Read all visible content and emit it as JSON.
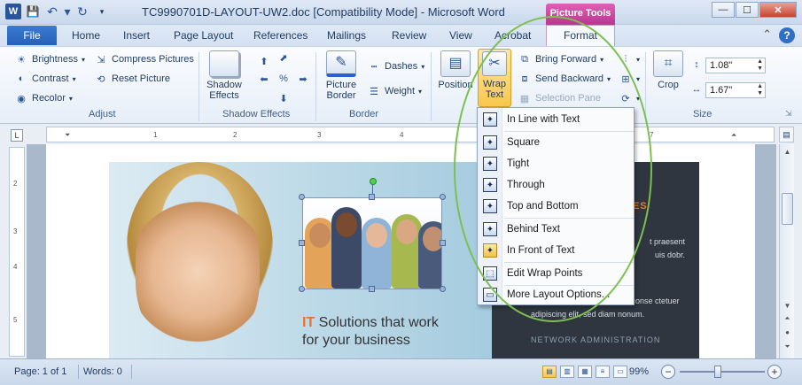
{
  "titlebar": {
    "title": "TC9990701D-LAYOUT-UW2.doc [Compatibility Mode] - Microsoft Word",
    "contextual_tab": "Picture Tools",
    "word_icon": "W"
  },
  "tabs": {
    "file": "File",
    "items": [
      "Home",
      "Insert",
      "Page Layout",
      "References",
      "Mailings",
      "Review",
      "View",
      "Acrobat"
    ],
    "format": "Format"
  },
  "ribbon": {
    "adjust": {
      "brightness": "Brightness",
      "contrast": "Contrast",
      "recolor": "Recolor",
      "compress": "Compress Pictures",
      "reset": "Reset Picture",
      "label": "Adjust"
    },
    "shadow": {
      "shadow_effects_l1": "Shadow",
      "shadow_effects_l2": "Effects",
      "label": "Shadow Effects"
    },
    "border": {
      "picture_border_l1": "Picture",
      "picture_border_l2": "Border",
      "dashes": "Dashes",
      "weight": "Weight",
      "label": "Border"
    },
    "arrange": {
      "position": "Position",
      "wrap_l1": "Wrap",
      "wrap_l2": "Text",
      "bring_forward": "Bring Forward",
      "send_backward": "Send Backward",
      "selection_pane": "Selection Pane"
    },
    "size": {
      "crop": "Crop",
      "height": "1.08\"",
      "width": "1.67\"",
      "label": "Size"
    }
  },
  "wrap_menu": {
    "items": [
      {
        "label": "In Line with Text",
        "icon": "inline-icon"
      },
      {
        "label": "Square",
        "icon": "square-wrap-icon"
      },
      {
        "label": "Tight",
        "icon": "tight-wrap-icon"
      },
      {
        "label": "Through",
        "icon": "through-wrap-icon"
      },
      {
        "label": "Top and Bottom",
        "icon": "top-bottom-wrap-icon"
      },
      {
        "label": "Behind Text",
        "icon": "behind-text-icon"
      },
      {
        "label": "In Front of Text",
        "icon": "in-front-text-icon"
      },
      {
        "label": "Edit Wrap Points",
        "icon": "edit-wrap-points-icon"
      },
      {
        "label": "More Layout Options...",
        "icon": "more-layout-icon"
      }
    ]
  },
  "document": {
    "tagline_it": "IT",
    "tagline_rest": " Solutions that work",
    "tagline_line2": "for your business",
    "panel_heading": "CES",
    "panel_para1": "t praesent\nuis dobr.",
    "panel_para2": "Lorem ipsum dolor sit amet, conse ctetuer adipiscing elit, sed diam nonum.",
    "panel_footer": "NETWORK ADMINISTRATION"
  },
  "statusbar": {
    "page": "Page: 1 of 1",
    "words": "Words: 0",
    "zoom": "99%"
  },
  "colors": {
    "accent_orange": "#e8742b",
    "annotation_green": "#7dbf50",
    "picture_tools": "#c2429c",
    "file_tab": "#2d66bf"
  }
}
